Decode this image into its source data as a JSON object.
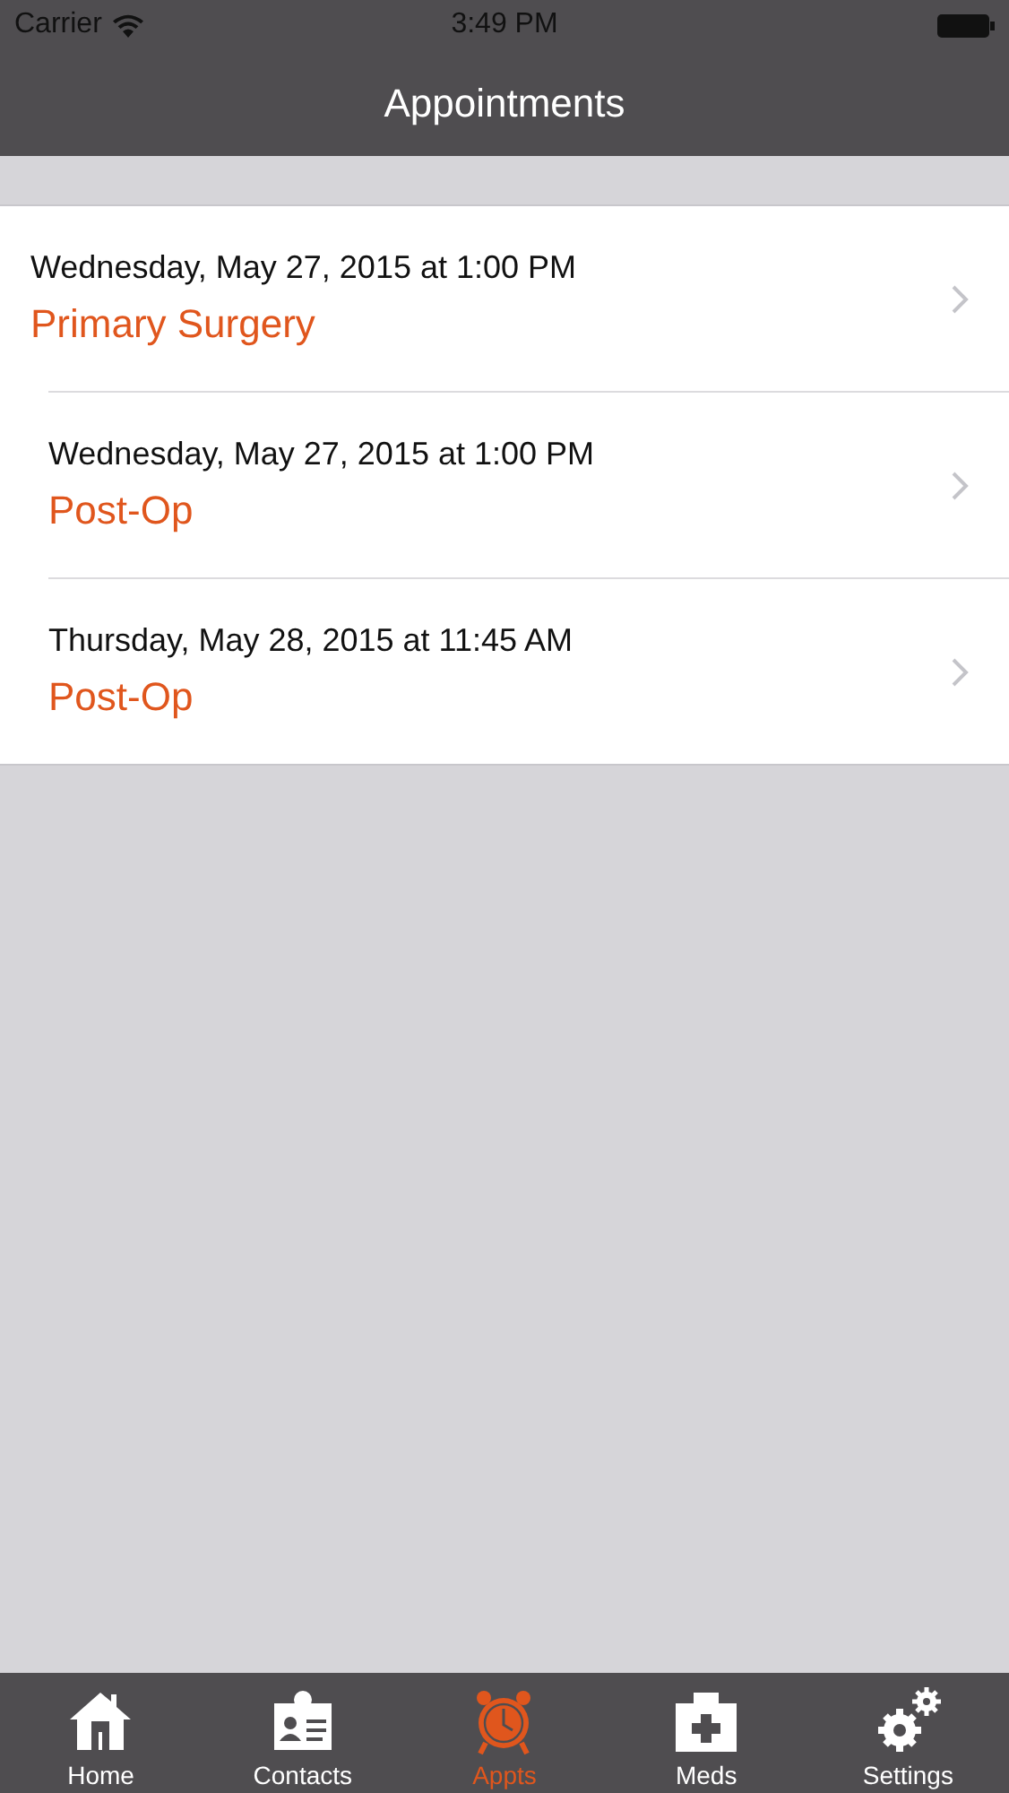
{
  "status_bar": {
    "carrier": "Carrier",
    "time": "3:49 PM"
  },
  "nav_bar": {
    "title": "Appointments"
  },
  "appointments": [
    {
      "datetime": "Wednesday, May 27, 2015 at 1:00 PM",
      "title": "Primary Surgery"
    },
    {
      "datetime": "Wednesday, May 27, 2015 at 1:00 PM",
      "title": "Post-Op"
    },
    {
      "datetime": "Thursday, May 28, 2015 at 11:45 AM",
      "title": "Post-Op"
    }
  ],
  "tab_bar": [
    {
      "label": "Home",
      "selected": false
    },
    {
      "label": "Contacts",
      "selected": false
    },
    {
      "label": "Appts",
      "selected": true
    },
    {
      "label": "Meds",
      "selected": false
    },
    {
      "label": "Settings",
      "selected": false
    }
  ]
}
